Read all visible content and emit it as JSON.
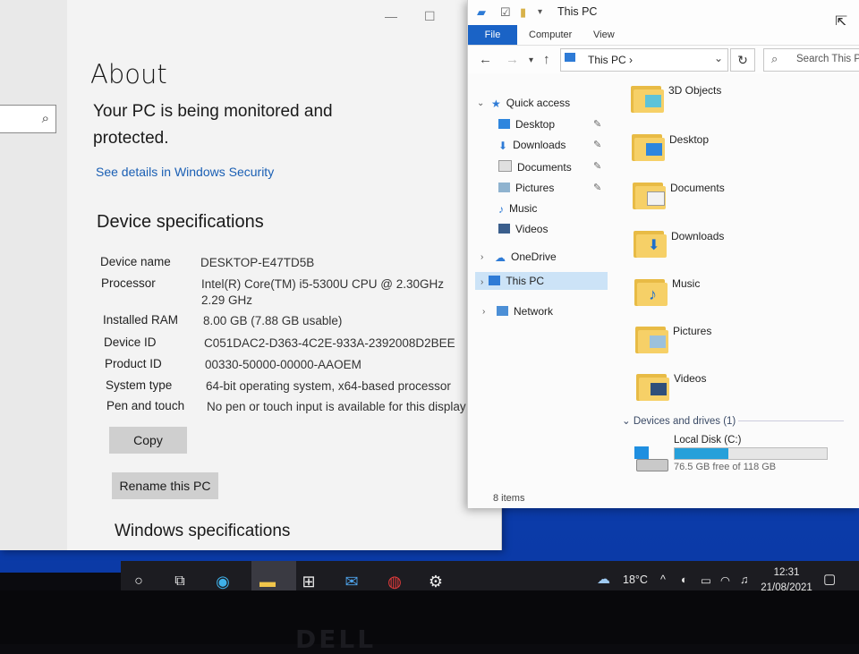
{
  "settings": {
    "search_icon": "search-icon",
    "title": "About",
    "protection_status": "Your PC is being monitored and protected.",
    "security_link": "See details in Windows Security",
    "device_specs_heading": "Device specifications",
    "specs": [
      {
        "label": "Device name",
        "value": "DESKTOP-E47TD5B"
      },
      {
        "label": "Processor",
        "value": "Intel(R) Core(TM) i5-5300U CPU @ 2.30GHz   2.29 GHz"
      },
      {
        "label": "Installed RAM",
        "value": "8.00 GB (7.88 GB usable)"
      },
      {
        "label": "Device ID",
        "value": "C051DAC2-D363-4C2E-933A-2392008D2BEE"
      },
      {
        "label": "Product ID",
        "value": "00330-50000-00000-AAOEM"
      },
      {
        "label": "System type",
        "value": "64-bit operating system, x64-based processor"
      },
      {
        "label": "Pen and touch",
        "value": "No pen or touch input is available for this display"
      }
    ],
    "copy_button": "Copy",
    "rename_button": "Rename this PC",
    "windows_specs_heading": "Windows specifications"
  },
  "explorer": {
    "window_title": "This PC",
    "ribbon_tabs": {
      "file": "File",
      "computer": "Computer",
      "view": "View"
    },
    "address": "This PC",
    "address_sep": "›",
    "search_placeholder": "Search This PC",
    "nav": {
      "quick_access": "Quick access",
      "desktop": "Desktop",
      "downloads": "Downloads",
      "documents": "Documents",
      "pictures": "Pictures",
      "music": "Music",
      "videos": "Videos",
      "onedrive": "OneDrive",
      "this_pc": "This PC",
      "network": "Network"
    },
    "folders": [
      "3D Objects",
      "Desktop",
      "Documents",
      "Downloads",
      "Music",
      "Pictures",
      "Videos"
    ],
    "devices_header": "Devices and drives (1)",
    "drive": {
      "name": "Local Disk (C:)",
      "free_text": "76.5 GB free of 118 GB",
      "used_fraction": 0.352
    },
    "status": "8 items",
    "accent": "#1a63c6"
  },
  "taskbar": {
    "weather_temp": "18°C",
    "time": "12:31",
    "date": "21/08/2021",
    "icons": [
      "search-circle-icon",
      "task-view-icon",
      "edge-icon",
      "file-explorer-icon",
      "store-icon",
      "mail-icon",
      "app-red-icon",
      "settings-gear-icon"
    ]
  },
  "bezel_logo": "DELL"
}
